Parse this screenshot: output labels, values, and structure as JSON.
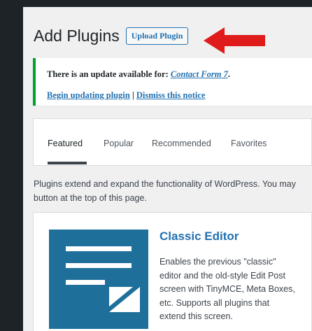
{
  "page": {
    "title": "Add Plugins",
    "upload_label": "Upload Plugin"
  },
  "notice": {
    "prefix": "There is an update available for: ",
    "plugin_link": "Contact Form 7",
    "suffix": ".",
    "begin_link": "Begin updating plugin",
    "separator": " | ",
    "dismiss_link": "Dismiss this notice",
    "border_color": "#00a32a"
  },
  "tabs": [
    {
      "label": "Featured",
      "active": true
    },
    {
      "label": "Popular",
      "active": false
    },
    {
      "label": "Recommended",
      "active": false
    },
    {
      "label": "Favorites",
      "active": false
    }
  ],
  "description": {
    "line1": "Plugins extend and expand the functionality of WordPress. You may",
    "line2": "button at the top of this page."
  },
  "plugin_card": {
    "name": "Classic Editor",
    "icon": "classic-editor-icon",
    "icon_color": "#1f6f9b",
    "description_lines": [
      "Enables the previous \"classic\"",
      "editor and the old-style Edit Post",
      "screen with TinyMCE, Meta Boxes,",
      "etc. Supports all plugins that",
      "extend this screen."
    ]
  },
  "colors": {
    "link": "#2271b1",
    "arrow": "#e01b1b",
    "admin_bar": "#1d2327"
  }
}
